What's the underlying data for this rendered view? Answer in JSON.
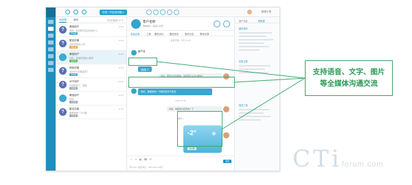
{
  "callout": {
    "line1": "支持语音、文字、图片",
    "line2": "等全媒体沟通交流"
  },
  "watermark": {
    "brand_a": "CTi",
    "brand_b": "forum.com"
  },
  "topbar": {
    "status": "在线 • 开启自动接入",
    "agent_name": "客服小美"
  },
  "list": {
    "tabs": [
      "待处理",
      "我的"
    ],
    "notice": "今日已接待 12 人",
    "items": [
      {
        "avatar": "?",
        "name": "微信用户",
        "text": "你好，请问你们这边支持什么",
        "tag": "已分配",
        "time": "14:20"
      },
      {
        "avatar": "?",
        "name": "匿名访客",
        "text": "请问发票怎么开？",
        "tag": "待处理",
        "time": "14:12"
      },
      {
        "avatar": "",
        "name": "微信用户",
        "text": "好的，谢谢你的耐心解答",
        "tag": "进行中",
        "time": "13:58"
      },
      {
        "avatar": "?",
        "name": "网站访客",
        "text": "请问什么时候发货？",
        "tag": "已分配",
        "time": "13:40"
      },
      {
        "avatar": "?",
        "name": "APP用户",
        "text": "已经收到了，谢谢",
        "tag": "已结束",
        "time": "13:22"
      },
      {
        "avatar": "",
        "name": "微信用户",
        "text": "好的",
        "tag": "已结束",
        "time": "12:57"
      },
      {
        "avatar": "?",
        "name": "匿名访客",
        "text": "我想咨询一下价格",
        "tag": "已结束",
        "time": "12:31"
      }
    ]
  },
  "chat": {
    "name": "客户名称",
    "sub": "微信用户 • 来自公众号",
    "tabs": [
      "会话记录",
      "工单",
      "服务评价",
      "服务历史",
      "操作日志",
      "联系记录"
    ],
    "system_top": "会话开始 • 今天 14:20",
    "customer_label": "客户名",
    "voice_label": "[语音] 3\"",
    "agent_msg1": "您好，很高兴为您服务，请问有什么可以帮您？",
    "customer_text": "你好，我想查询一下明天的天气情况",
    "timestamp": "2016-07-30",
    "agent_msg2": "好的，稍等我为您查询一下",
    "image_label": "[图片]",
    "weather_temp": "-2°",
    "weather_icon": "❄",
    "weather_time": "16:38",
    "tools": "☺ ✂ ▣ ☎ ✉",
    "hint": "按 Enter 发送消息，Shift+Enter 换行",
    "send": "发送"
  },
  "info": {
    "tabs": [
      "客户信息",
      "常用语"
    ],
    "head1": "基本资料",
    "head2": "历史记录",
    "head3": "相关工单"
  }
}
